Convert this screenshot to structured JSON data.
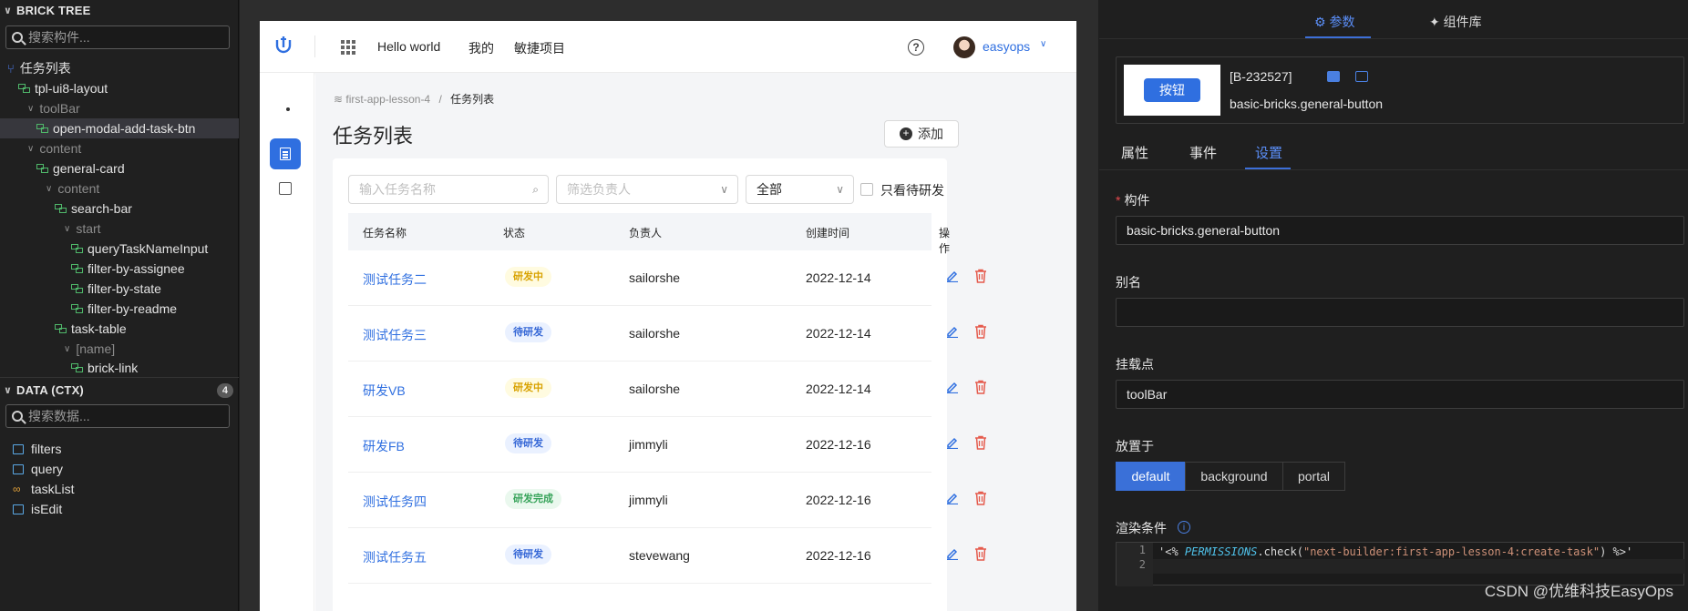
{
  "left": {
    "brick_tree": {
      "title": "BRICK TREE",
      "search_placeholder": "搜索构件...",
      "items": [
        {
          "label": "任务列表",
          "kind": "root"
        },
        {
          "label": "tpl-ui8-layout",
          "kind": "brick"
        },
        {
          "label": "toolBar",
          "kind": "slot"
        },
        {
          "label": "open-modal-add-task-btn",
          "kind": "brick",
          "selected": true
        },
        {
          "label": "content",
          "kind": "slot"
        },
        {
          "label": "general-card",
          "kind": "brick"
        },
        {
          "label": "content",
          "kind": "slot"
        },
        {
          "label": "search-bar",
          "kind": "brick"
        },
        {
          "label": "start",
          "kind": "slot"
        },
        {
          "label": "queryTaskNameInput",
          "kind": "brick"
        },
        {
          "label": "filter-by-assignee",
          "kind": "brick"
        },
        {
          "label": "filter-by-state",
          "kind": "brick"
        },
        {
          "label": "filter-by-readme",
          "kind": "brick"
        },
        {
          "label": "task-table",
          "kind": "brick"
        },
        {
          "label": "[name]",
          "kind": "slot"
        },
        {
          "label": "brick-link",
          "kind": "brick"
        }
      ]
    },
    "data_ctx": {
      "title": "DATA (CTX)",
      "count": "4",
      "search_placeholder": "搜索数据...",
      "items": [
        {
          "label": "filters",
          "icon": "function-icon"
        },
        {
          "label": "query",
          "icon": "function-icon"
        },
        {
          "label": "taskList",
          "icon": "link-icon"
        },
        {
          "label": "isEdit",
          "icon": "function-icon"
        }
      ]
    }
  },
  "app": {
    "nav": {
      "hello": "Hello world",
      "mine": "我的",
      "agile": "敏捷项目",
      "user": "easyops"
    },
    "breadcrumb": {
      "parent": "first-app-lesson-4",
      "sep": "/",
      "current": "任务列表"
    },
    "page_title": "任务列表",
    "add_button": "添加",
    "filters": {
      "name_placeholder": "输入任务名称",
      "assignee_placeholder": "筛选负责人",
      "state_value": "全部",
      "readme_label": "只看待研发"
    },
    "table": {
      "headers": [
        "任务名称",
        "状态",
        "负责人",
        "创建时间",
        "操作"
      ],
      "rows": [
        {
          "name": "测试任务二",
          "status": "研发中",
          "status_type": "dev",
          "assignee": "sailorshe",
          "created": "2022-12-14"
        },
        {
          "name": "测试任务三",
          "status": "待研发",
          "status_type": "todo",
          "assignee": "sailorshe",
          "created": "2022-12-14"
        },
        {
          "name": "研发VB",
          "status": "研发中",
          "status_type": "dev",
          "assignee": "sailorshe",
          "created": "2022-12-14"
        },
        {
          "name": "研发FB",
          "status": "待研发",
          "status_type": "todo",
          "assignee": "jimmyli",
          "created": "2022-12-16"
        },
        {
          "name": "测试任务四",
          "status": "研发完成",
          "status_type": "done",
          "assignee": "jimmyli",
          "created": "2022-12-16"
        },
        {
          "name": "测试任务五",
          "status": "待研发",
          "status_type": "todo",
          "assignee": "stevewang",
          "created": "2022-12-16"
        }
      ]
    }
  },
  "right": {
    "tabs": {
      "params": "参数",
      "library": "组件库"
    },
    "preview": {
      "button_label": "按钮",
      "id": "[B-232527]",
      "name": "basic-bricks.general-button"
    },
    "subtabs": {
      "props": "属性",
      "events": "事件",
      "settings": "设置"
    },
    "fields": {
      "brick_label": "构件",
      "brick_value": "basic-bricks.general-button",
      "alias_label": "别名",
      "alias_value": "",
      "mount_label": "挂载点",
      "mount_value": "toolBar",
      "portal_label": "放置于",
      "portal_options": [
        "default",
        "background",
        "portal"
      ],
      "portal_selected": "default",
      "if_label": "渲染条件",
      "code_line1_a": "'<% ",
      "code_line1_k": "PERMISSIONS",
      "code_line1_b": ".check(",
      "code_line1_s": "\"next-builder:first-app-lesson-4:create-task\"",
      "code_line1_c": ") %>'",
      "gutter": [
        "1",
        "2"
      ]
    }
  },
  "watermark": "CSDN @优维科技EasyOps",
  "colors": {
    "accent": "#2f6fe0",
    "dev": "#d8a200",
    "todo": "#3567d6",
    "done": "#37a35a",
    "danger": "#e55b4d"
  }
}
